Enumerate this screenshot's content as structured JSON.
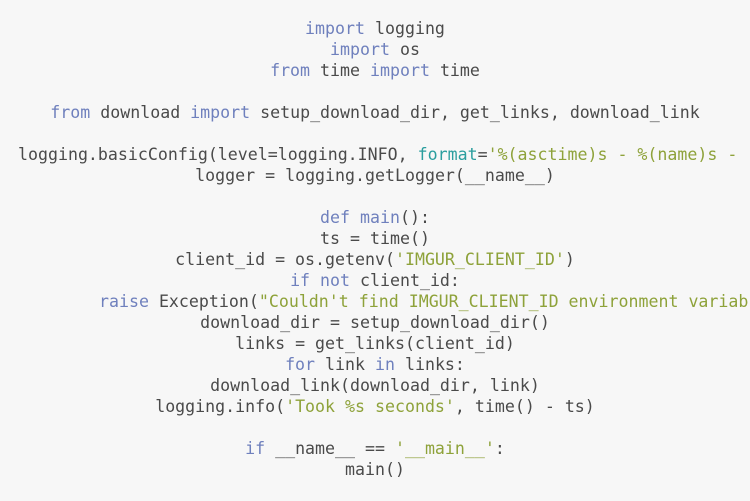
{
  "code": {
    "line1": {
      "kw1": "import",
      "mod": " logging"
    },
    "line2": {
      "kw1": "import",
      "mod": " os"
    },
    "line3": {
      "kw1": "from",
      "mod": " time ",
      "kw2": "import",
      "name": " time"
    },
    "line4": {
      "kw1": "from",
      "mod": " download ",
      "kw2": "import",
      "names": " setup_download_dir, get_links, download_link"
    },
    "line5": {
      "pre": "logging.basicConfig(level=logging.INFO, ",
      "arg": "format",
      "eq": "=",
      "str": "'%(asctime)s - %(name)s -"
    },
    "line6": {
      "text": "logger = logging.getLogger(__name__)"
    },
    "line7": {
      "kw": "def",
      "sp": " ",
      "fn": "main",
      "rest": "():"
    },
    "line8": {
      "text": "ts = time()"
    },
    "line9": {
      "pre": "client_id = os.getenv(",
      "str": "'IMGUR_CLIENT_ID'",
      "post": ")"
    },
    "line10": {
      "kw": "if",
      "kw2": " not",
      "rest": " client_id:"
    },
    "line11": {
      "kw": "raise",
      "pre": " Exception(",
      "str": "\"Couldn't find IMGUR_CLIENT_ID environment variab"
    },
    "line12": {
      "text": "download_dir = setup_download_dir()"
    },
    "line13": {
      "text": "links = get_links(client_id)"
    },
    "line14": {
      "kw": "for",
      "mid": " link ",
      "kw2": "in",
      "rest": " links:"
    },
    "line15": {
      "text": "download_link(download_dir, link)"
    },
    "line16": {
      "pre": "logging.info(",
      "str": "'Took %s seconds'",
      "post": ", time() - ts)"
    },
    "line17": {
      "kw": "if",
      "pre": " __name__ == ",
      "str": "'__main__'",
      "post": ":"
    },
    "line18": {
      "text": "main()"
    }
  }
}
